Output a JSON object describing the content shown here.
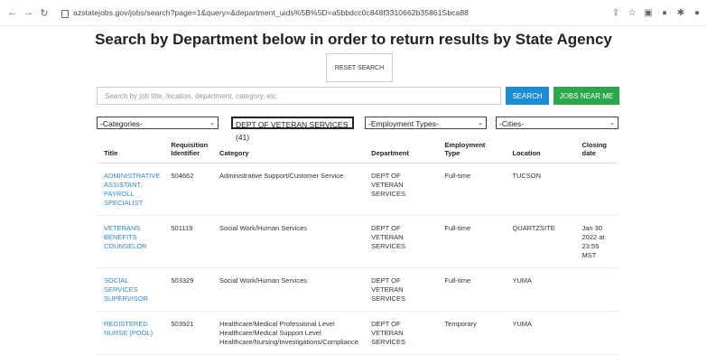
{
  "browser": {
    "url": "azstatejobs.gov/jobs/search?page=1&query=&department_uids%5B%5D=a5bbdcc0c848f3310662b35861Sbca88"
  },
  "page": {
    "title": "Search by Department below in order to return results by State Agency",
    "reset_label": "RESET SEARCH",
    "search_placeholder": "Search by job title, location, department, category, etc.",
    "search_label": "SEARCH",
    "near_label": "JOBS NEAR ME"
  },
  "filters": {
    "categories": "-Categories-",
    "department": "DEPT OF VETERAN SERVICES (41)",
    "employment": "-Employment Types-",
    "cities": "-Cities-"
  },
  "table": {
    "headers": {
      "title": "Title",
      "requisition": "Requisition Identifier",
      "category": "Category",
      "department": "Department",
      "employment": "Employment Type",
      "location": "Location",
      "closing": "Closing date"
    },
    "rows": [
      {
        "title": "ADMINISTRATIVE ASSISTANT, PAYROLL SPECIALIST",
        "req": "504662",
        "category": "Administrative Support/Customer Service",
        "dept": "DEPT OF VETERAN SERVICES",
        "emp": "Full-time",
        "loc": "TUCSON",
        "close": ""
      },
      {
        "title": "VETERANS BENEFITS COUNSELOR",
        "req": "501119",
        "category": "Social Work/Human Services",
        "dept": "DEPT OF VETERAN SERVICES",
        "emp": "Full-time",
        "loc": "QUARTZSITE",
        "close": "Jan 30 2022 at 23:55 MST"
      },
      {
        "title": "SOCIAL SERVICES SUPERVISOR",
        "req": "503329",
        "category": "Social Work/Human Services",
        "dept": "DEPT OF VETERAN SERVICES",
        "emp": "Full-time",
        "loc": "YUMA",
        "close": ""
      },
      {
        "title": "REGISTERED NURSE (POOL)",
        "req": "503921",
        "category": "Healthcare/Medical Professional Level Healthcare/Medical Support Level Healthcare/Nursing/Investigations/Compliance",
        "dept": "DEPT OF VETERAN SERVICES",
        "emp": "Temporary",
        "loc": "YUMA",
        "close": ""
      }
    ]
  }
}
